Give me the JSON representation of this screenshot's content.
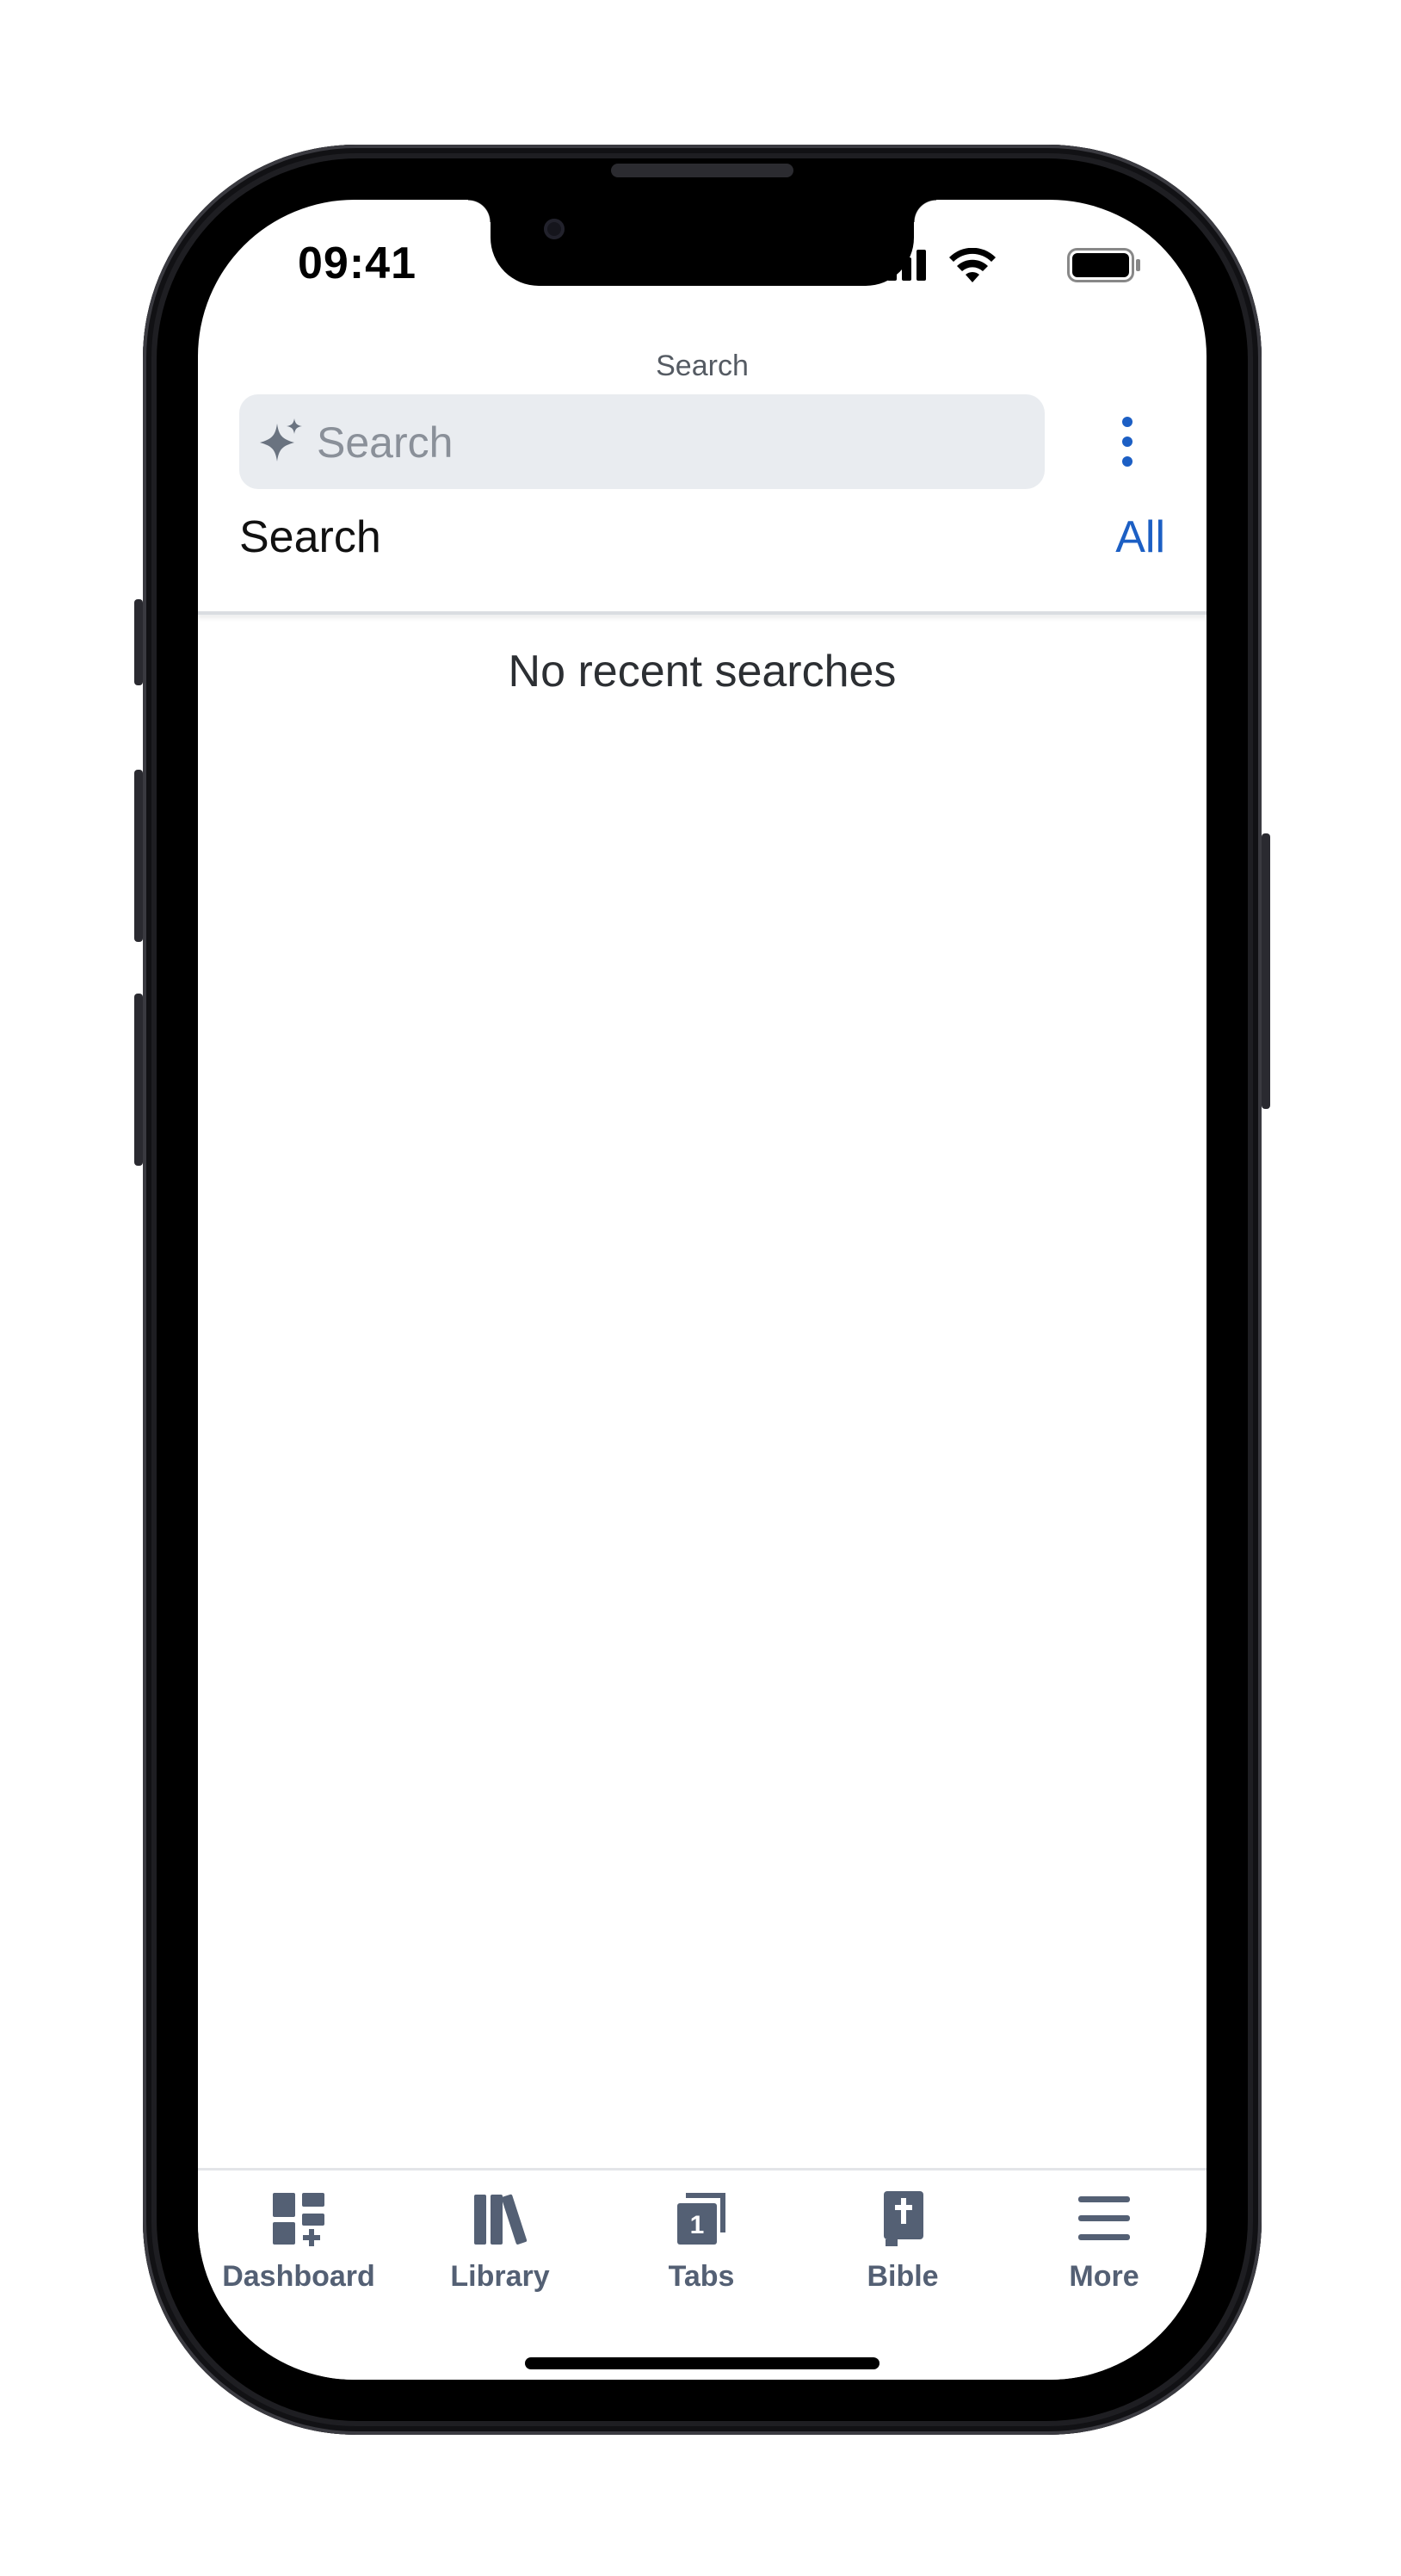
{
  "status_bar": {
    "time": "09:41"
  },
  "header": {
    "title": "Search"
  },
  "search": {
    "placeholder": "Search"
  },
  "section": {
    "title": "Search",
    "scope": "All"
  },
  "empty_state": {
    "message": "No recent searches"
  },
  "tab_bar": {
    "items": [
      {
        "label": "Dashboard",
        "icon": "dashboard-icon"
      },
      {
        "label": "Library",
        "icon": "library-icon"
      },
      {
        "label": "Tabs",
        "icon": "tabs-icon",
        "badge": "1"
      },
      {
        "label": "Bible",
        "icon": "bible-icon"
      },
      {
        "label": "More",
        "icon": "hamburger-menu-icon"
      }
    ]
  },
  "colors": {
    "accent": "#1c5fc4",
    "tab_icon": "#546074",
    "search_background": "#e9ecf0"
  }
}
